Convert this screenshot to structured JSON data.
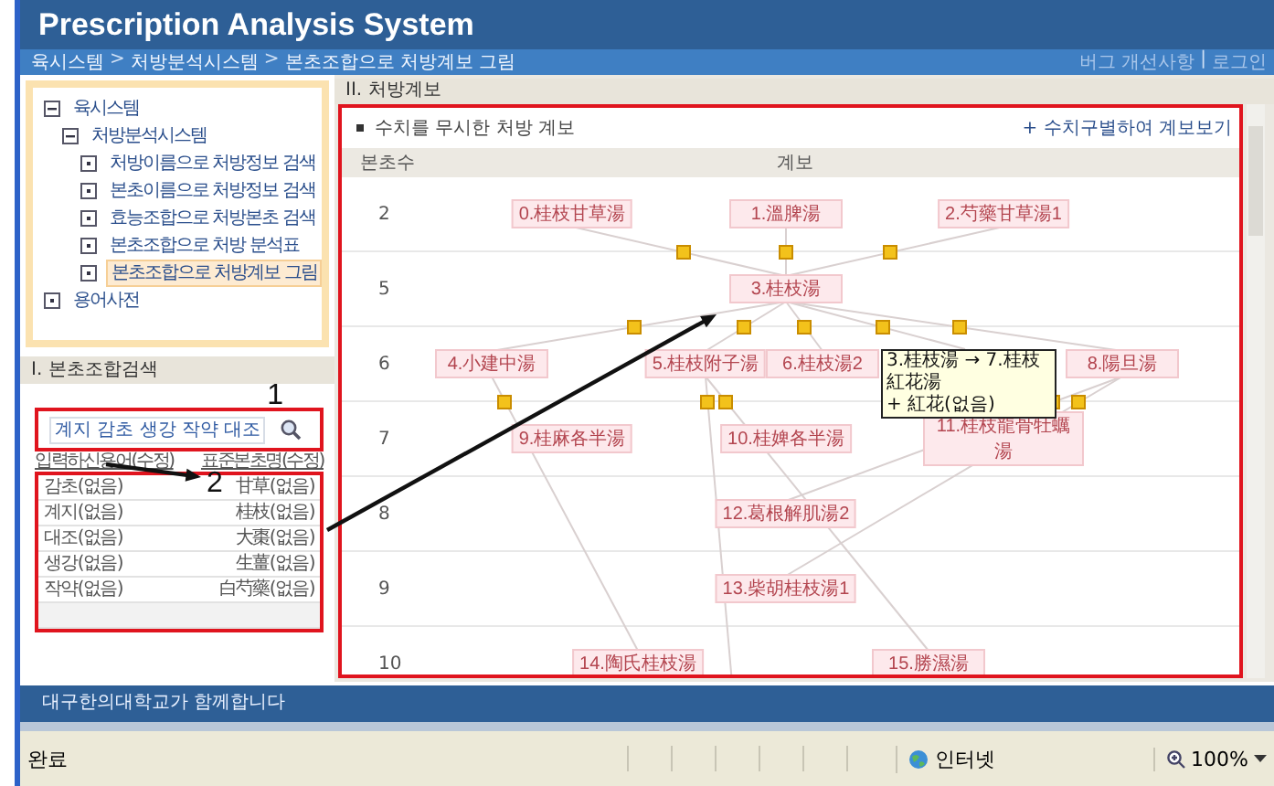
{
  "window": {
    "title": "Prescription Analysis System"
  },
  "breadcrumb": {
    "items": [
      "육시스템",
      "처방분석시스템",
      "본초조합으로 처방계보 그림"
    ],
    "separator": ">"
  },
  "header_links": {
    "items": [
      "버그 개선사항",
      "로그인"
    ],
    "separator": "|"
  },
  "nav_tree": [
    {
      "label": "육시스템",
      "expanded": true,
      "selected": false,
      "children": [
        {
          "label": "처방분석시스템",
          "expanded": true,
          "selected": false,
          "children": [
            {
              "label": "처방이름으로 처방정보 검색",
              "expanded": false,
              "selected": false
            },
            {
              "label": "본초이름으로 처방정보 검색",
              "expanded": false,
              "selected": false
            },
            {
              "label": "효능조합으로 처방본초 검색",
              "expanded": false,
              "selected": false
            },
            {
              "label": "본초조합으로 처방 분석표",
              "expanded": false,
              "selected": false
            },
            {
              "label": "본초조합으로 처방계보 그림",
              "expanded": false,
              "selected": true
            }
          ]
        }
      ]
    },
    {
      "label": "용어사전",
      "expanded": false,
      "selected": false
    }
  ],
  "herb_search": {
    "title": "I. 본초조합검색",
    "query": "계지 감초 생강 작약 대조",
    "columns": [
      "입력하신용어(수정)",
      "표준본초명(수정)"
    ],
    "rows": [
      [
        "감초(없음)",
        "甘草(없음)"
      ],
      [
        "계지(없음)",
        "桂枝(없음)"
      ],
      [
        "대조(없음)",
        "大棗(없음)"
      ],
      [
        "생강(없음)",
        "生薑(없음)"
      ],
      [
        "작약(없음)",
        "白芍藥(없음)"
      ]
    ]
  },
  "lineage": {
    "title": "II. 처방계보",
    "subtitle": "수치를 무시한 처방 계보",
    "toggle_link": "+ 수치구별하여 계보보기",
    "columns": [
      "본초수",
      "계보"
    ],
    "rows": [
      {
        "count": "2",
        "nodes": [
          "0.桂枝甘草湯",
          "1.溫脾湯",
          "2.芍藥甘草湯1"
        ]
      },
      {
        "count": "5",
        "nodes": [
          "3.桂枝湯"
        ]
      },
      {
        "count": "6",
        "nodes": [
          "4.小建中湯",
          "5.桂枝附子湯",
          "6.桂枝湯2",
          "8.陽旦湯"
        ]
      },
      {
        "count": "7",
        "nodes": [
          "9.桂麻各半湯",
          "10.桂婢各半湯",
          "11.桂枝龍骨牡蠣湯"
        ]
      },
      {
        "count": "8",
        "nodes": [
          "12.葛根解肌湯2"
        ]
      },
      {
        "count": "9",
        "nodes": [
          "13.柴胡桂枝湯1"
        ]
      },
      {
        "count": "10",
        "nodes": [
          "14.陶氏桂枝湯",
          "15.勝濕湯"
        ]
      }
    ],
    "tooltip": "3.桂枝湯 → 7.桂枝紅花湯\n+ 紅花(없음)"
  },
  "annotations": [
    {
      "label": "1"
    },
    {
      "label": "2"
    }
  ],
  "footer": "대구한의대학교가 함께합니다",
  "status_bar": {
    "status": "완료",
    "zone": "인터넷",
    "zoom": "100%"
  }
}
